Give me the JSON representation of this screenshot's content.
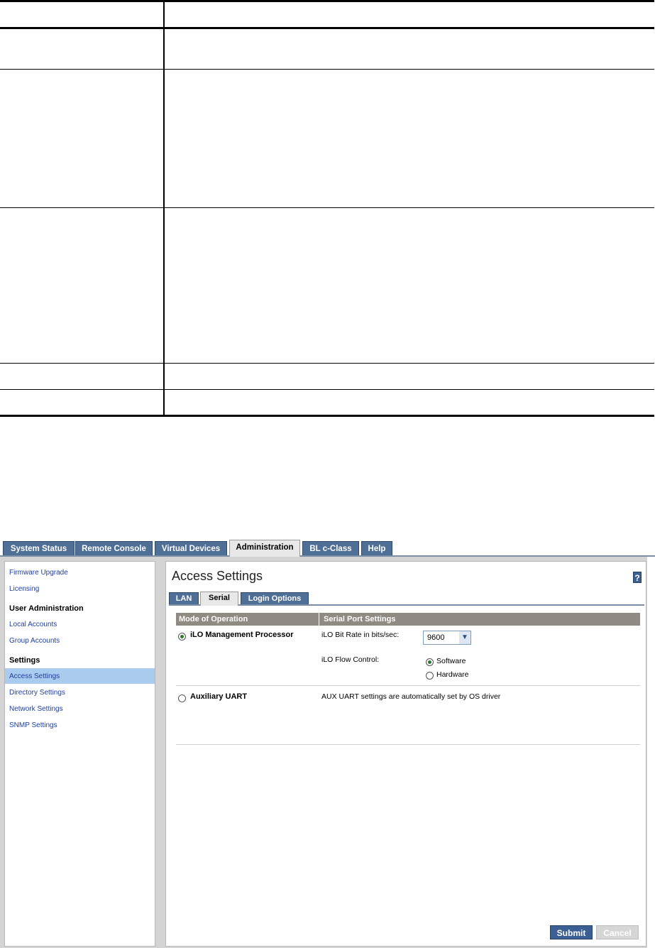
{
  "top_nav": {
    "tabs": [
      {
        "label": "System Status"
      },
      {
        "label": "Remote Console"
      },
      {
        "label": "Virtual Devices"
      },
      {
        "label": "Administration",
        "active": true
      },
      {
        "label": "BL c-Class"
      },
      {
        "label": "Help"
      }
    ]
  },
  "sidebar": {
    "links_top": [
      "Firmware Upgrade",
      "Licensing"
    ],
    "heading_user": "User Administration",
    "links_user": [
      "Local Accounts",
      "Group Accounts"
    ],
    "heading_settings": "Settings",
    "links_settings": [
      "Access Settings",
      "Directory Settings",
      "Network Settings",
      "SNMP Settings"
    ],
    "active_item": "Access Settings"
  },
  "main": {
    "title": "Access Settings",
    "help_icon": "?",
    "subtabs": [
      {
        "label": "LAN"
      },
      {
        "label": "Serial",
        "active": true
      },
      {
        "label": "Login Options"
      }
    ],
    "table_headers": [
      "Mode of Operation",
      "Serial Port Settings"
    ],
    "ilo_mode_label": "iLO Management Processor",
    "bit_rate_label": "iLO Bit Rate in bits/sec:",
    "bit_rate_value": "9600",
    "flow_control_label": "iLO Flow Control:",
    "flow_options": [
      "Software",
      "Hardware"
    ],
    "flow_selected": "Software",
    "aux_mode_label": "Auxiliary UART",
    "aux_note": "AUX UART settings are automatically set by OS driver",
    "submit_label": "Submit",
    "cancel_label": "Cancel"
  }
}
